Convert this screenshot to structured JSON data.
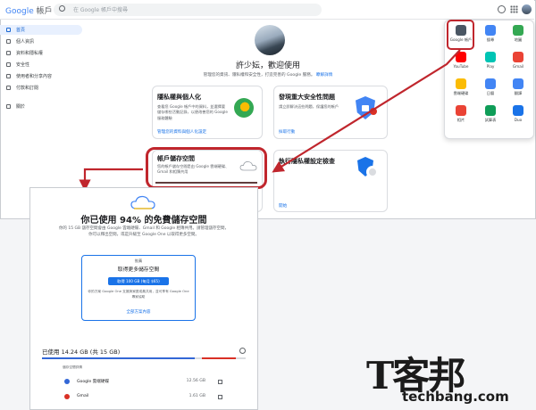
{
  "header": {
    "brand": "Google",
    "brand_suffix": "帳戶",
    "search_placeholder": "在 Google 帳戶中搜尋"
  },
  "sidebar": {
    "items": [
      {
        "label": "首頁",
        "active": true
      },
      {
        "label": "個人資訊"
      },
      {
        "label": "資料和隱私權"
      },
      {
        "label": "安全性"
      },
      {
        "label": "使用者和分享內容"
      },
      {
        "label": "付款和訂閱"
      },
      {
        "label": "關於"
      }
    ]
  },
  "home": {
    "welcome": "許少妘，歡迎使用",
    "subtitle": "管理您的資訊、隱私權和安全性，打造完善的 Google 服務。",
    "subtitle_link": "瞭解詳情"
  },
  "cards": [
    {
      "title": "隱私權與個人化",
      "desc": "查看您 Google 帳戶中的資料，並選擇要儲存哪些活動記錄，以便改善您的 Google 服務體驗",
      "link": "管理您的資料與個人化設定"
    },
    {
      "title": "發現重大安全性問題",
      "desc": "請立即解決這些問題，保護您的帳戶",
      "link": "採取行動"
    },
    {
      "title": "帳戶儲存空間",
      "desc": "您的帳戶儲存空間是由 Google 雲端硬碟、Gmail 和相簿共用"
    },
    {
      "title": "執行隱私權設定檢查",
      "desc": "",
      "link": "開始"
    }
  ],
  "apps": [
    {
      "label": "Google 帳戶",
      "color": "#4a5663"
    },
    {
      "label": "搜尋",
      "color": "#4285f4"
    },
    {
      "label": "地圖",
      "color": "#34a853"
    },
    {
      "label": "YouTube",
      "color": "#ff0000"
    },
    {
      "label": "Play",
      "color": "#00c4b4"
    },
    {
      "label": "Gmail",
      "color": "#ea4335"
    },
    {
      "label": "雲端硬碟",
      "color": "#fbbc04"
    },
    {
      "label": "日曆",
      "color": "#4285f4"
    },
    {
      "label": "翻譯",
      "color": "#4285f4"
    },
    {
      "label": "相片",
      "color": "#ea4335"
    },
    {
      "label": "試算表",
      "color": "#0f9d58"
    },
    {
      "label": "Duo",
      "color": "#1a73e8"
    }
  ],
  "storage_panel": {
    "title": "你已使用 94% 的免費儲存空間",
    "desc_line1": "你的 15 GB 儲存空間會由 Google 雲端硬碟、Gmail 和 Google 相簿共用。請管理儲存空間，",
    "desc_line2": "你可以釋出空間，或是升級至 Google One 以取得更多空間。",
    "offer_eyebrow": "推薦",
    "offer_title": "取得更多儲存空間",
    "offer_button": "取得 100 GB (每月 $65)",
    "offer_note": "你的方案 Google One 支援與家庭成員共用，並可享有 Google One 專家協助",
    "offer_link": "全部方案內容",
    "used_label": "已使用 14.24 GB (共 15 GB)",
    "used_fraction": 0.94,
    "breakdown_header": "儲存空間詳情",
    "rows": [
      {
        "name": "Google 雲端硬碟",
        "size": "12.56 GB",
        "color": "#3367d6"
      },
      {
        "name": "Gmail",
        "size": "1.61 GB",
        "color": "#d93025"
      }
    ]
  },
  "watermark": {
    "logo": "T客邦",
    "url": "techbang.com"
  }
}
